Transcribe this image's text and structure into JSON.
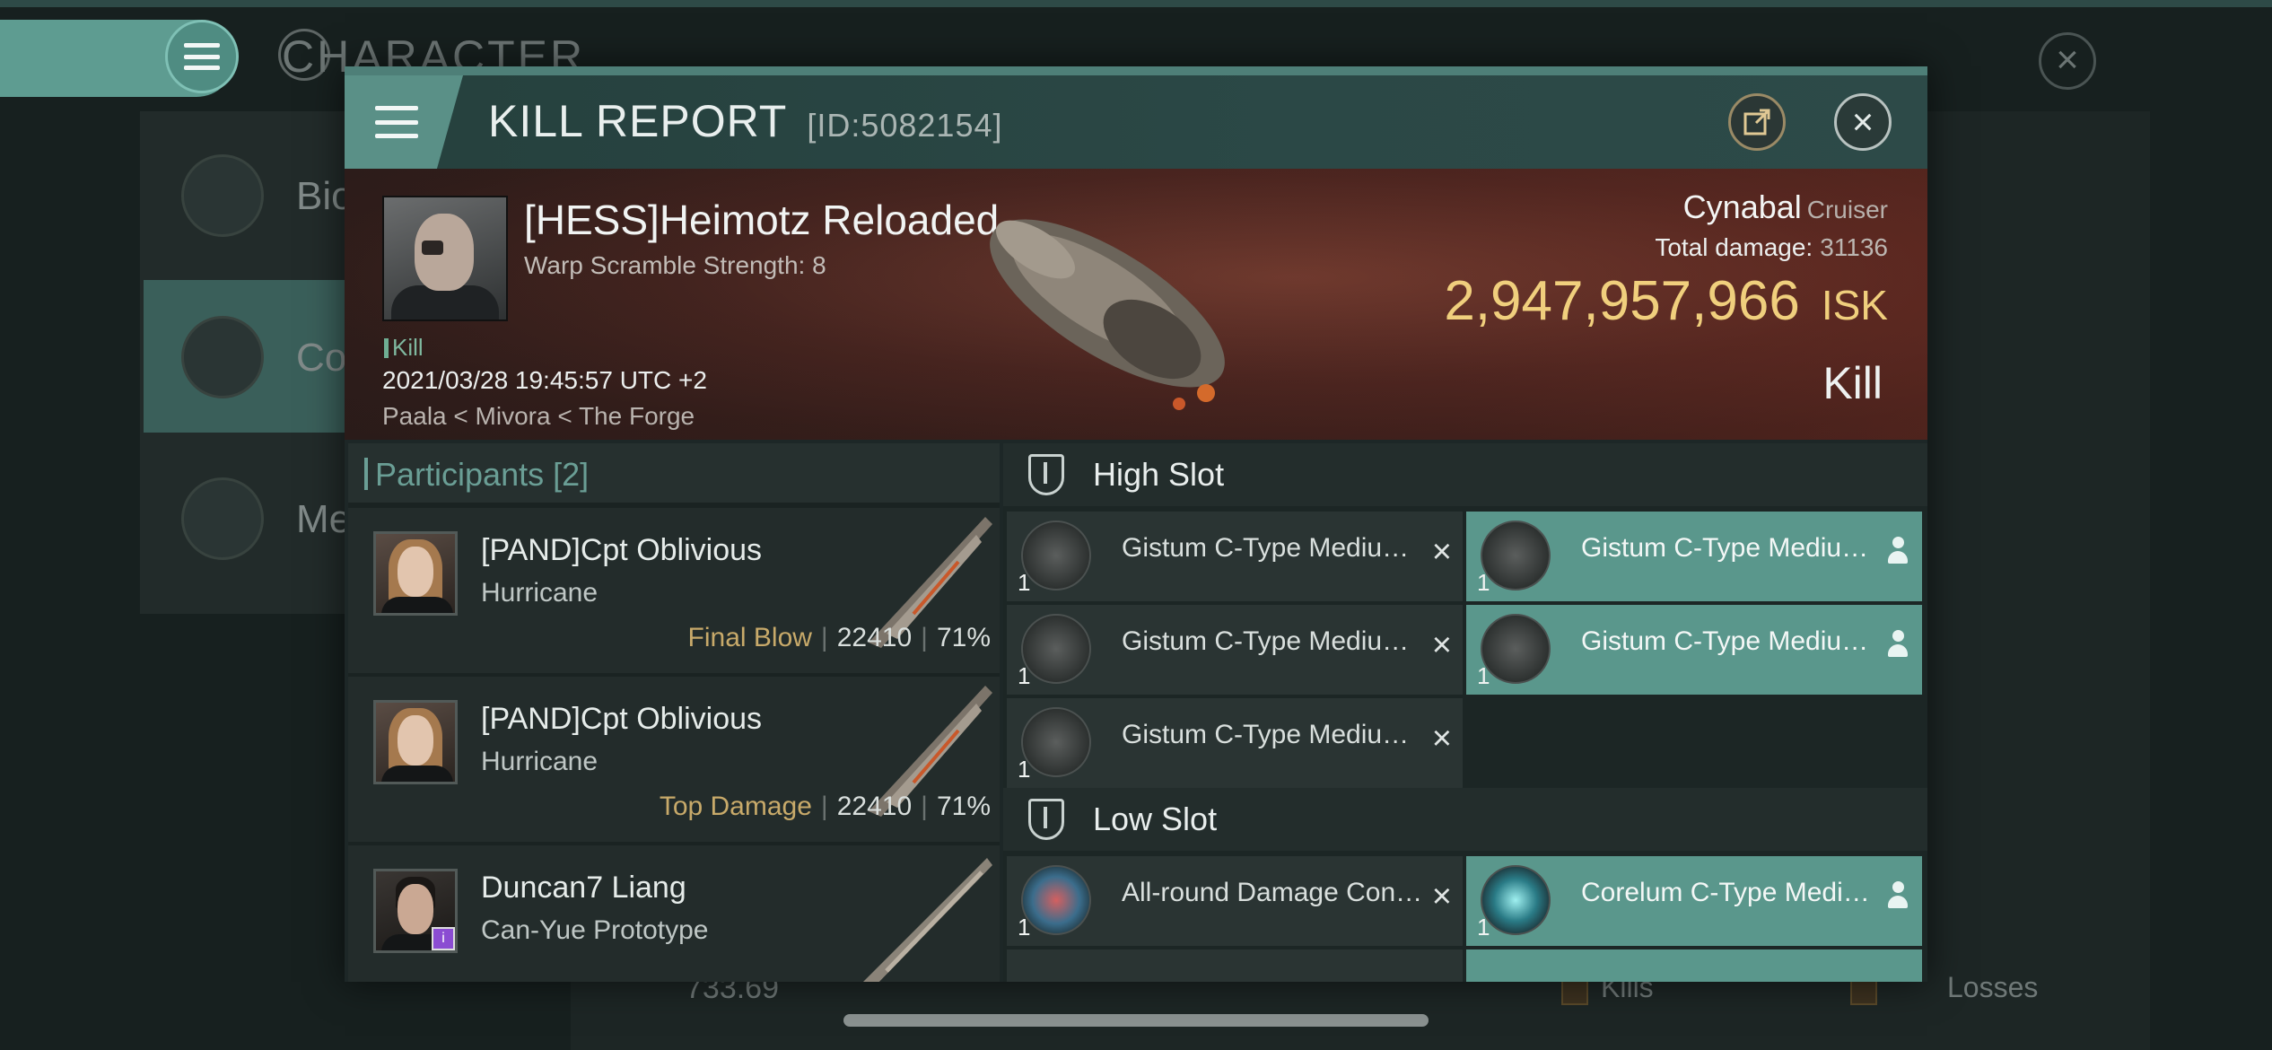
{
  "background": {
    "title": "CHARACTER",
    "sidebar": [
      {
        "label": "Bio"
      },
      {
        "label": "Co"
      },
      {
        "label": "Me"
      }
    ],
    "wallet_value": "733.69",
    "kills_label": "Kills",
    "losses_label": "Losses"
  },
  "report": {
    "title": "KILL REPORT",
    "id": "[ID:5082154]"
  },
  "victim": {
    "name": "[HESS]Heimotz Reloaded",
    "subtitle": "Warp Scramble Strength: 8",
    "tag": "Kill",
    "timestamp": "2021/03/28 19:45:57 UTC +2",
    "location": "Paala < Mivora < The Forge",
    "ship": "Cynabal",
    "ship_class": "Cruiser",
    "damage_label": "Total damage:",
    "damage_value": "31136",
    "isk_value": "2,947,957,966",
    "isk_unit": "ISK",
    "result": "Kill"
  },
  "participants": {
    "label": "Participants",
    "count": "[2]",
    "rows": [
      {
        "name": "[PAND]Cpt Oblivious",
        "ship": "Hurricane",
        "role": "Final Blow",
        "damage": "22410",
        "percent": "71%"
      },
      {
        "name": "[PAND]Cpt Oblivious",
        "ship": "Hurricane",
        "role": "Top Damage",
        "damage": "22410",
        "percent": "71%"
      },
      {
        "name": "Duncan7 Liang",
        "ship": "Can-Yue Prototype",
        "role": "",
        "damage": "",
        "percent": ""
      }
    ]
  },
  "high_slot": {
    "label": "High Slot",
    "modules": [
      {
        "name": "Gistum C-Type Medium...",
        "qty": "1",
        "state": "destroyed"
      },
      {
        "name": "Gistum C-Type Medium...",
        "qty": "1",
        "state": "dropped"
      },
      {
        "name": "Gistum C-Type Medium...",
        "qty": "1",
        "state": "destroyed"
      },
      {
        "name": "Gistum C-Type Medium...",
        "qty": "1",
        "state": "dropped"
      },
      {
        "name": "Gistum C-Type Medium...",
        "qty": "1",
        "state": "destroyed"
      }
    ]
  },
  "low_slot": {
    "label": "Low Slot",
    "modules": [
      {
        "name": "All-round Damage Control",
        "qty": "1",
        "state": "destroyed"
      },
      {
        "name": "Corelum C-Type Medium...",
        "qty": "1",
        "state": "dropped"
      }
    ]
  },
  "icons": {
    "menu": "hamburger-icon",
    "export": "external-link-icon",
    "close": "close-icon",
    "destroyed": "x-icon",
    "dropped": "person-icon"
  },
  "colors": {
    "accent": "#5a978c",
    "isk": "#f0cf7d",
    "final_blow": "#c8aa6a"
  }
}
